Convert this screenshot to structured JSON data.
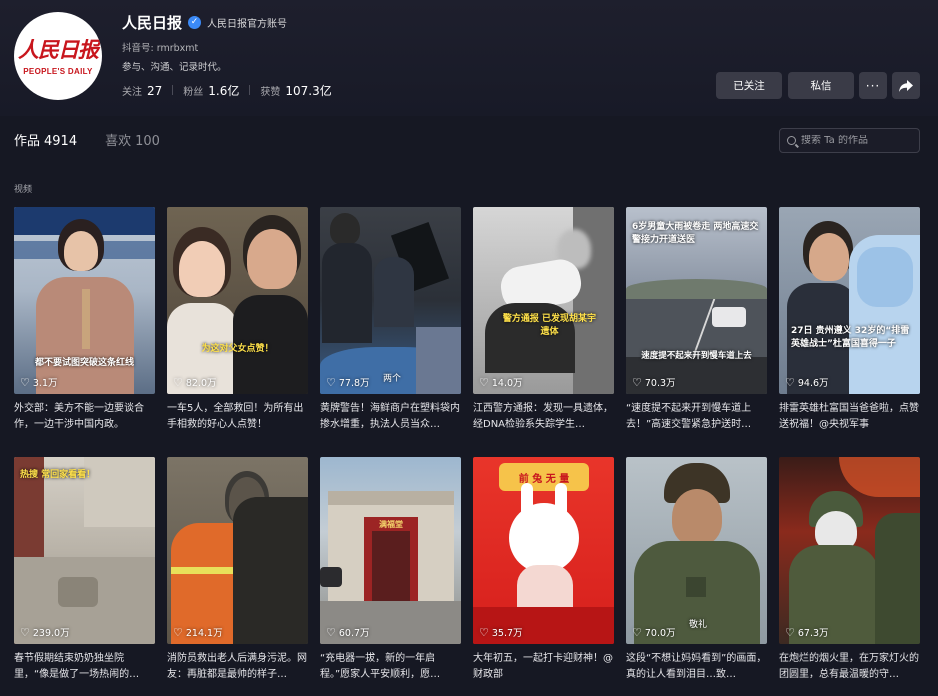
{
  "profile": {
    "avatar_text_cn": "人民日报",
    "avatar_text_en": "PEOPLE'S DAILY",
    "name": "人民日报",
    "verified_label": "人民日报官方账号",
    "account_id": "抖音号: rmrbxmt",
    "bio": "参与、沟通、记录时代。",
    "stats": [
      {
        "label": "关注",
        "value": "27"
      },
      {
        "label": "粉丝",
        "value": "1.6亿"
      },
      {
        "label": "获赞",
        "value": "107.3亿"
      }
    ],
    "buttons": {
      "followed": "已关注",
      "message": "私信",
      "more": "···"
    }
  },
  "tabs": [
    {
      "label": "作品",
      "count": "4914",
      "active": true
    },
    {
      "label": "喜欢",
      "count": "100",
      "active": false
    }
  ],
  "search": {
    "placeholder": "搜索 Ta 的作品"
  },
  "section_label": "视频",
  "videos": [
    {
      "likes": "3.1万",
      "overlay": "都不要试图突破这条红线",
      "caption": "外交部：美方不能一边要谈合作，一边干涉中国内政。"
    },
    {
      "likes": "82.0万",
      "overlay": "为这对父女点赞！",
      "caption": "一车5人，全部救回！为所有出手相救的好心人点赞！"
    },
    {
      "likes": "77.8万",
      "overlay": "",
      "badge": "两个",
      "caption": "黄牌警告！海鲜商户在塑料袋内掺水增重，执法人员当众…"
    },
    {
      "likes": "14.0万",
      "overlay": "警方通报 已发现胡某宇遗体",
      "caption": "江西警方通报：发现一具遗体，经DNA检验系失踪学生…"
    },
    {
      "likes": "70.3万",
      "overlay": "6岁男童大雨被卷走 两地高速交警接力开道送医",
      "overlay2": "速度提不起来开到慢车道上去",
      "caption": "“速度提不起来开到慢车道上去！”高速交警紧急护送时…"
    },
    {
      "likes": "94.6万",
      "overlay": "27日 贵州遵义 32岁的“排雷英雄战士”杜富国喜得一子",
      "caption": "排雷英雄杜富国当爸爸啦，点赞送祝福！@央视军事"
    },
    {
      "likes": "239.0万",
      "overlay": "热搜 常回家看看！",
      "caption": "春节假期结束奶奶独坐院里，“像是做了一场热闹的…"
    },
    {
      "likes": "214.1万",
      "overlay": "",
      "caption": "消防员救出老人后满身污泥。网友：再脏都是最帅的样子…"
    },
    {
      "likes": "60.7万",
      "overlay": "满福堂",
      "caption": "“充电器一拔，新的一年启程。”愿家人平安顺利，愿…"
    },
    {
      "likes": "35.7万",
      "overlay": "前 兔 无 量",
      "caption": "大年初五，一起打卡迎财神！@财政部"
    },
    {
      "likes": "70.0万",
      "overlay": "",
      "badge": "敬礼",
      "caption": "这段“不想让妈妈看到”的画面，真的让人看到泪目…致…"
    },
    {
      "likes": "67.3万",
      "overlay": "",
      "caption": "在炮烂的烟火里，在万家灯火的团圆里，总有最温暖的守…"
    }
  ]
}
